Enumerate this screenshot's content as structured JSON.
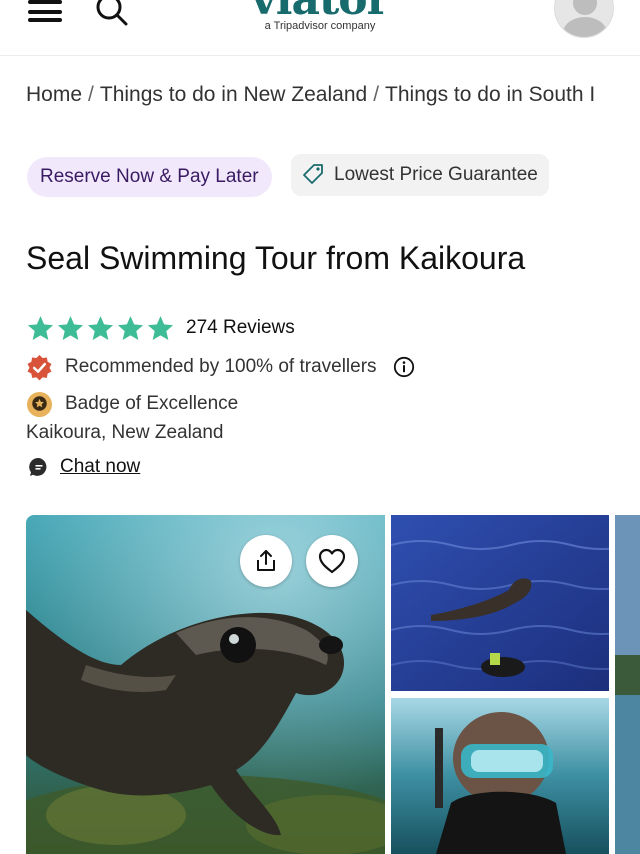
{
  "header": {
    "logo_text": "viator",
    "logo_subtitle": "a Tripadvisor company",
    "icons": {
      "menu": "hamburger-menu-icon",
      "search": "search-icon",
      "account": "user-avatar-icon"
    }
  },
  "breadcrumb": [
    "Home",
    "Things to do in New Zealand",
    "Things to do in South I"
  ],
  "badges": {
    "reserve": "Reserve Now & Pay Later",
    "lowest_price": "Lowest Price Guarantee"
  },
  "title": "Seal Swimming Tour from Kaikoura",
  "rating": {
    "stars": 5,
    "reviews_label": "274 Reviews"
  },
  "recommended": "Recommended by 100% of travellers",
  "excellence": "Badge of Excellence",
  "location": "Kaikoura, New Zealand",
  "chat": "Chat now",
  "colors": {
    "brand_teal": "#186b6d",
    "star_green": "#3ebc96",
    "reserve_bg": "#f1e9fb",
    "reserve_text": "#3a1a62",
    "recommend_red": "#d9533b",
    "excellence_gold": "#e8b25d"
  },
  "gallery": {
    "images": [
      "seal-underwater-photo",
      "seal-on-surface-photo",
      "snorkeler-selfie-photo",
      "coastline-photo"
    ],
    "share_icon": "share-icon",
    "favorite_icon": "heart-icon"
  }
}
